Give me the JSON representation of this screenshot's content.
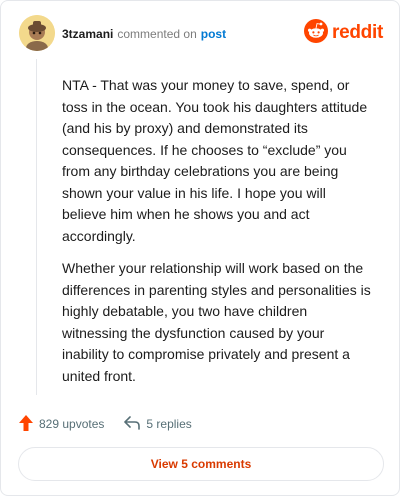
{
  "header": {
    "username": "3tzamani",
    "action_text": "commented on",
    "post_link": "post",
    "brand": "reddit"
  },
  "comment": {
    "paragraphs": [
      "NTA - That was your money to save, spend, or toss in the ocean. You took his daughters attitude (and his by proxy) and demonstrated its consequences. If he chooses to “exclude” you from any birthday celebrations you are being shown your value in his life. I hope you will believe him when he shows you and act accordingly.",
      "Whether your relationship will work based on the differences in parenting styles and personalities is highly debatable, you two have children witnessing the dysfunction caused by your inability to compromise privately and present a united front."
    ]
  },
  "actions": {
    "upvotes_label": "829 upvotes",
    "replies_label": "5 replies"
  },
  "view_comments_label": "View 5 comments",
  "colors": {
    "brand": "#ff4500",
    "link": "#0079d3",
    "upvote": "#ff4500",
    "view_button_text": "#d93a00"
  },
  "icons": [
    "avatar",
    "reddit-logo-icon",
    "upvote-arrow-icon",
    "reply-arrow-icon"
  ]
}
